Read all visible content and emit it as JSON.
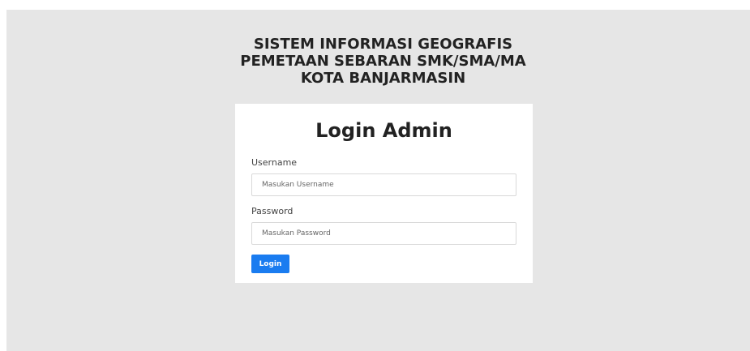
{
  "header": {
    "title_lines": [
      "SISTEM INFORMASI GEOGRAFIS",
      "PEMETAAN SEBARAN SMK/SMA/MA",
      "KOTA BANJARMASIN"
    ]
  },
  "login": {
    "heading": "Login Admin",
    "username": {
      "label": "Username",
      "placeholder": "Masukan Username",
      "value": ""
    },
    "password": {
      "label": "Password",
      "placeholder": "Masukan Password",
      "value": ""
    },
    "submit_label": "Login"
  },
  "colors": {
    "background": "#e6e6e6",
    "card": "#ffffff",
    "primary_button": "#1a7cf0",
    "heading_text": "#222222"
  }
}
